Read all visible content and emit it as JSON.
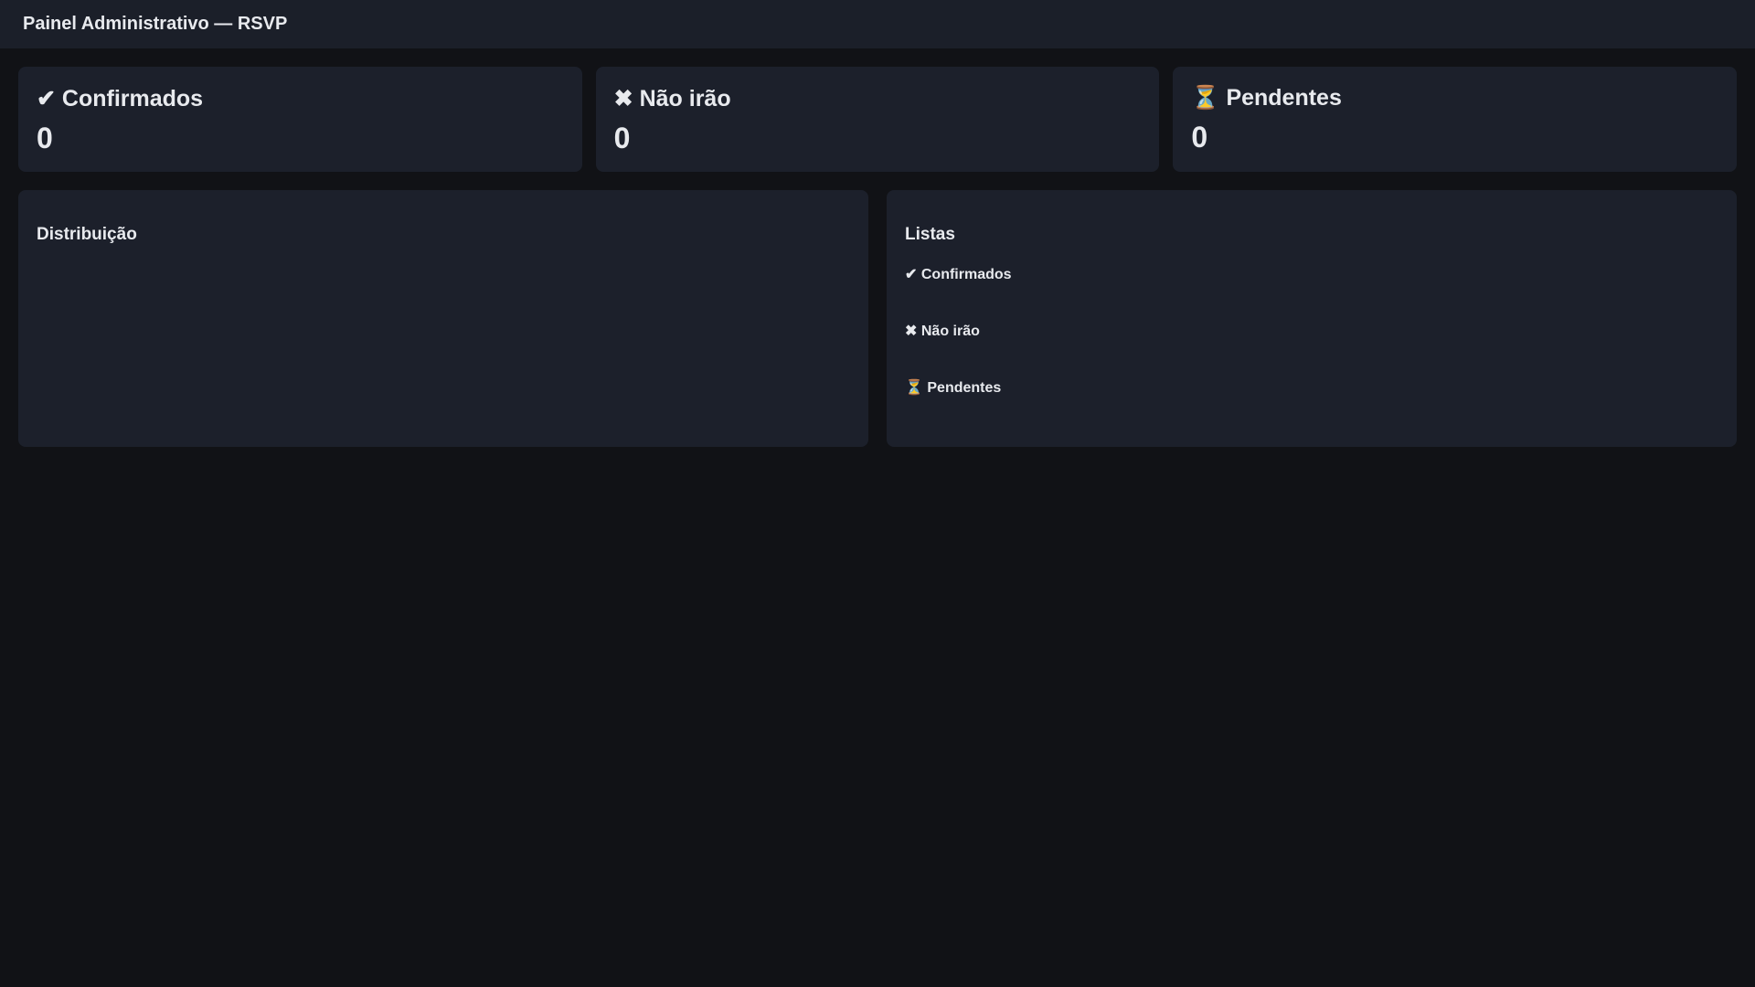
{
  "header": {
    "title": "Painel Administrativo — RSVP"
  },
  "stats": [
    {
      "icon": "✔",
      "label": "Confirmados",
      "value": "0"
    },
    {
      "icon": "✖",
      "label": "Não irão",
      "value": "0"
    },
    {
      "icon": "⏳",
      "label": "Pendentes",
      "value": "0"
    }
  ],
  "distribution": {
    "title": "Distribuição"
  },
  "lists": {
    "title": "Listas",
    "items": [
      {
        "icon": "✔",
        "label": "Confirmados"
      },
      {
        "icon": "✖",
        "label": "Não irão"
      },
      {
        "icon": "⏳",
        "label": "Pendentes"
      }
    ]
  }
}
